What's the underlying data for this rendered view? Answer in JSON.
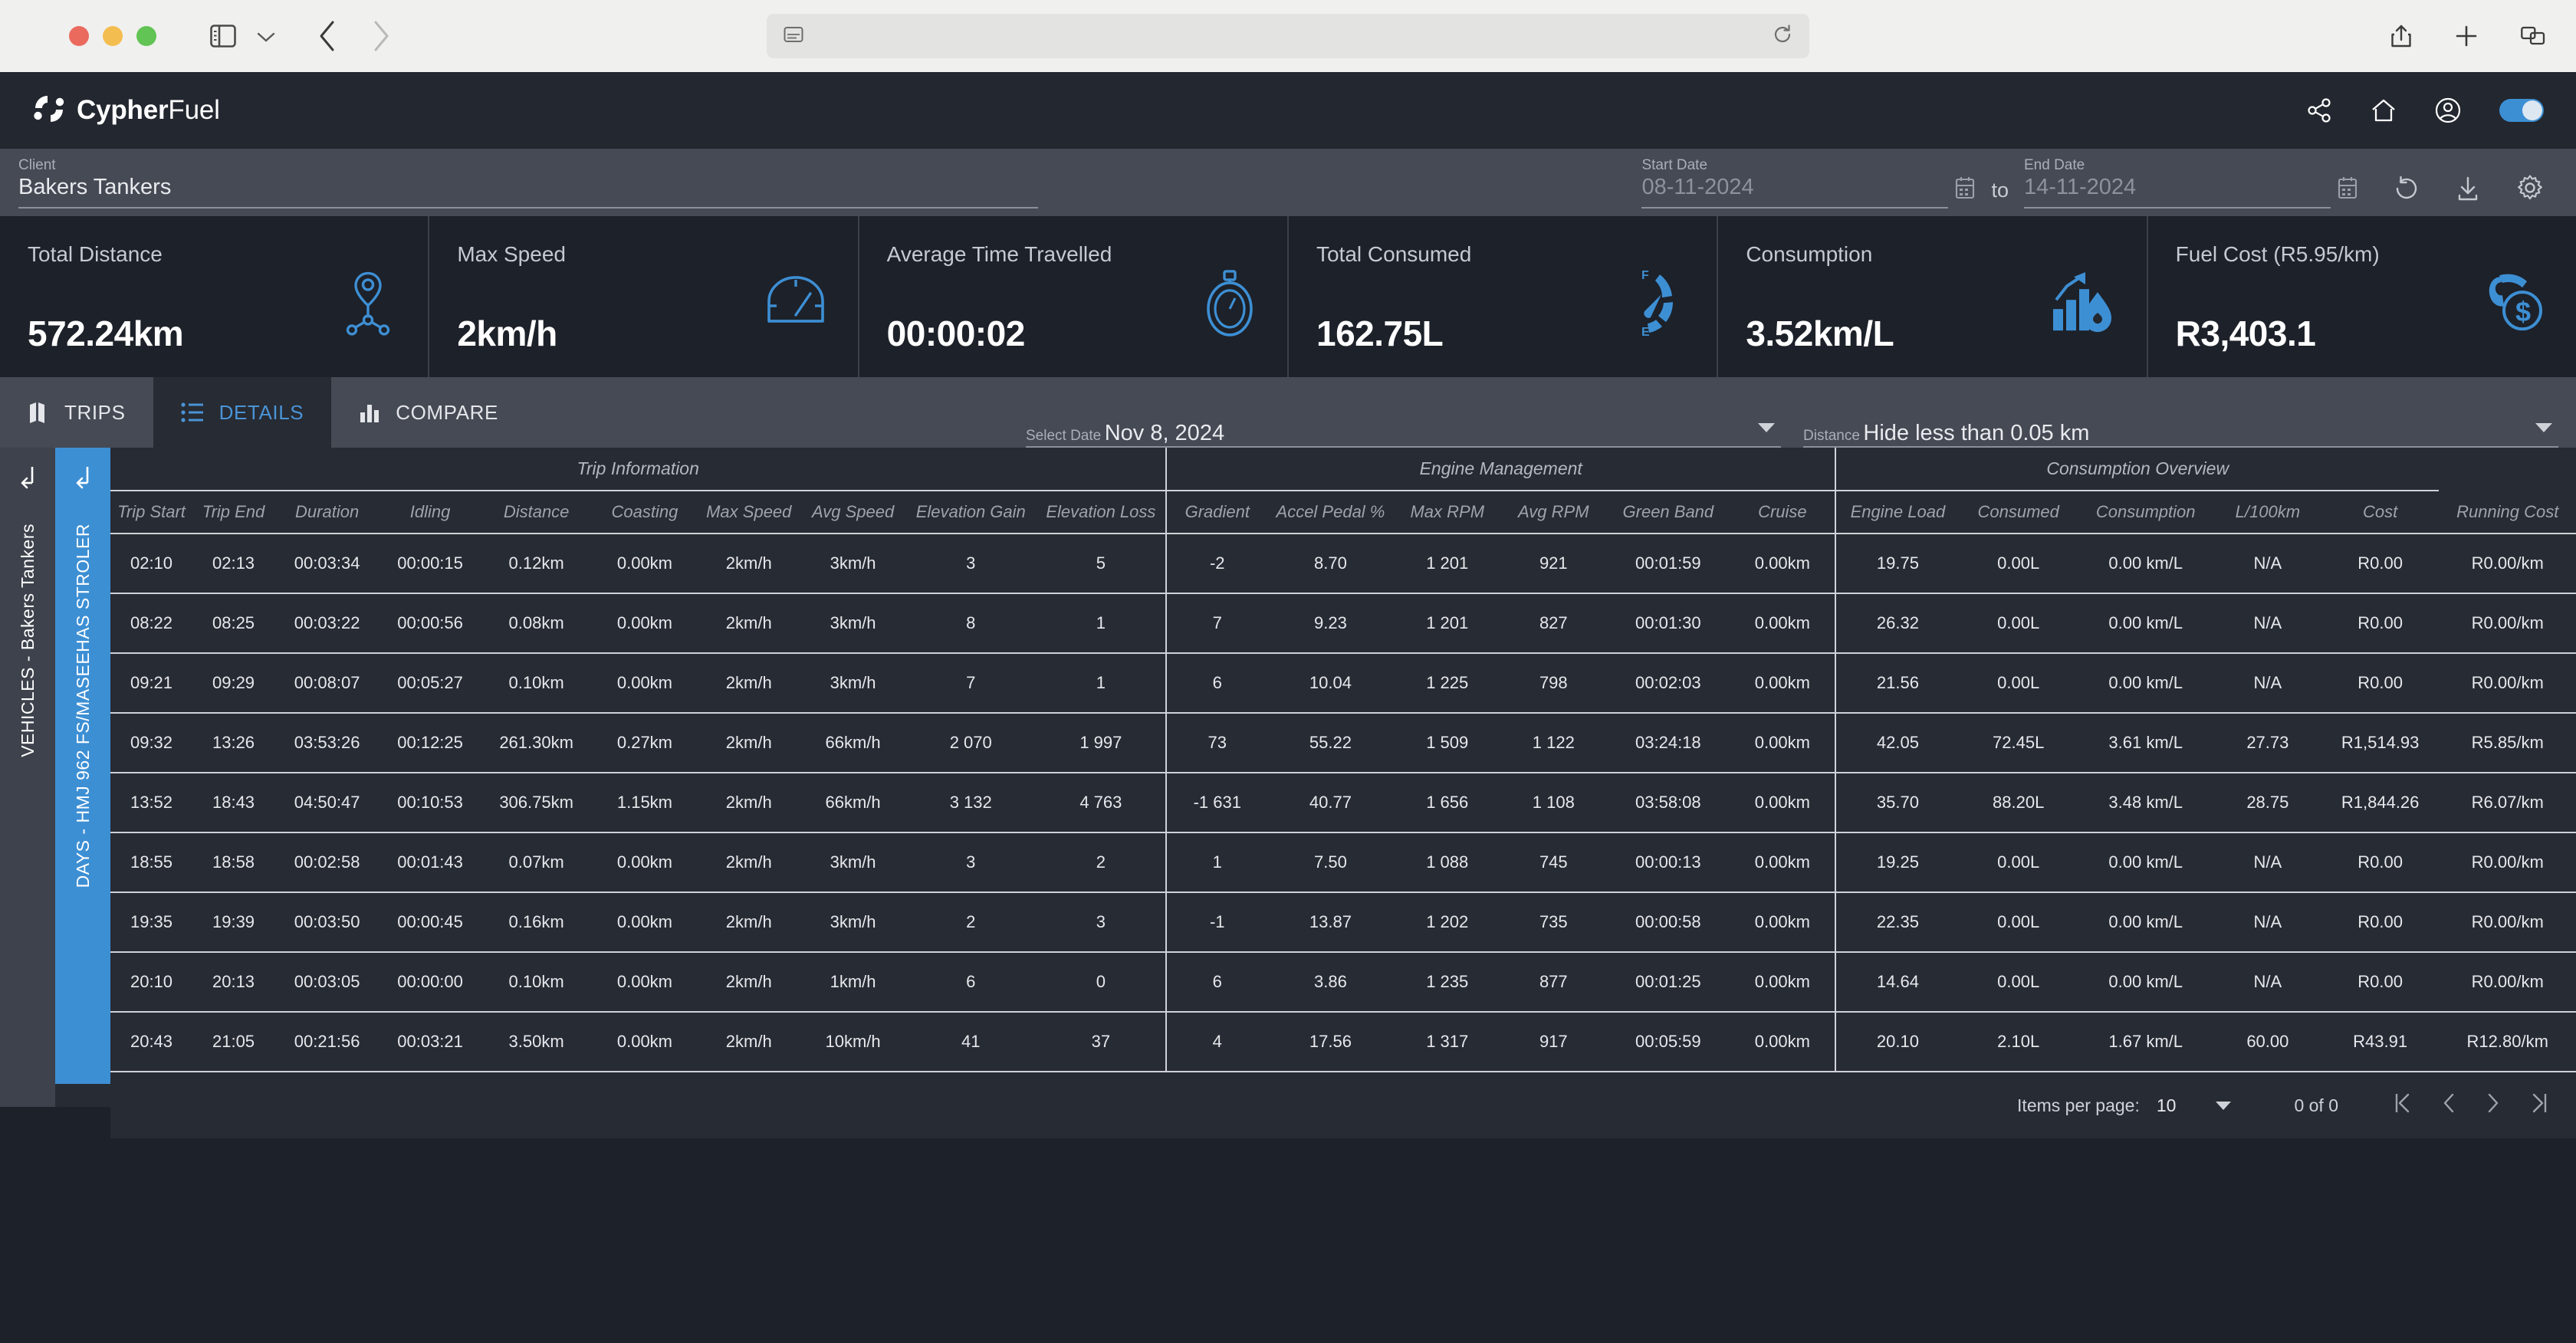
{
  "browser": {
    "traffic_lights": [
      "close",
      "minimize",
      "maximize"
    ],
    "sidebar_toggle_icon": "sidebar-icon",
    "tab_overview_icon": "chevron-down-icon",
    "back_icon": "chevron-left-icon",
    "forward_icon": "chevron-right-icon",
    "url_value": "",
    "url_placeholder": "",
    "reader_icon": "reader-view-icon",
    "reload_icon": "reload-icon",
    "share_icon": "share-icon",
    "new_tab_icon": "plus-icon",
    "tabs_icon": "tab-overview-icon"
  },
  "app_header": {
    "brand_bold": "Cypher",
    "brand_light": "Fuel",
    "logo_icon": "cypherfuel-logo-icon",
    "icons": [
      "share-icon",
      "home-icon",
      "account-icon"
    ],
    "theme_toggle": "dark-mode-toggle",
    "accent_color": "#3d8fd4"
  },
  "filters": {
    "client": {
      "label": "Client",
      "value": "Bakers Tankers"
    },
    "start_date": {
      "label": "Start Date",
      "value": "08-11-2024",
      "icon": "calendar-icon"
    },
    "separator": "to",
    "end_date": {
      "label": "End Date",
      "value": "14-11-2024",
      "icon": "calendar-icon"
    },
    "actions": [
      "refresh-icon",
      "download-icon",
      "settings-icon"
    ]
  },
  "kpis": [
    {
      "label": "Total Distance",
      "value": "572.24km",
      "icon": "route-pin-icon"
    },
    {
      "label": "Max Speed",
      "value": "2km/h",
      "icon": "speedometer-icon"
    },
    {
      "label": "Average Time Travelled",
      "value": "00:00:02",
      "icon": "stopwatch-icon"
    },
    {
      "label": "Total Consumed",
      "value": "162.75L",
      "icon": "fuel-gauge-icon"
    },
    {
      "label": "Consumption",
      "value": "3.52km/L",
      "icon": "bar-chart-droplet-icon"
    },
    {
      "label": "Fuel Cost (R5.95/km)",
      "value": "R3,403.1",
      "icon": "fuel-pump-dollar-icon"
    }
  ],
  "tabs": [
    {
      "label": "TRIPS",
      "icon": "map-icon",
      "active": false
    },
    {
      "label": "DETAILS",
      "icon": "list-icon",
      "active": true
    },
    {
      "label": "COMPARE",
      "icon": "bar-chart-icon",
      "active": false
    }
  ],
  "selectors": {
    "select_date": {
      "label": "Select Date",
      "value": "Nov 8, 2024"
    },
    "distance": {
      "label": "Distance",
      "value": "Hide less than 0.05 km"
    }
  },
  "side_rails": {
    "level1": {
      "text": "VEHICLES - Bakers Tankers",
      "arrow_icon": "collapse-arrow-icon"
    },
    "level2": {
      "text": "DAYS - HMJ 962 FS/MASEEHAS STROLER",
      "arrow_icon": "collapse-arrow-icon"
    }
  },
  "table": {
    "groups": [
      {
        "title": "Trip Information",
        "span": 10
      },
      {
        "title": "Engine Management",
        "span": 6
      },
      {
        "title": "Consumption Overview",
        "span": 5
      }
    ],
    "columns": [
      "Trip Start",
      "Trip End",
      "Duration",
      "Idling",
      "Distance",
      "Coasting",
      "Max Speed",
      "Avg Speed",
      "Elevation Gain",
      "Elevation Loss",
      "Gradient",
      "Accel Pedal %",
      "Max RPM",
      "Avg RPM",
      "Green Band",
      "Cruise",
      "Engine Load",
      "Consumed",
      "Consumption",
      "L/100km",
      "Cost",
      "Running Cost"
    ],
    "rows": [
      [
        "02:10",
        "02:13",
        "00:03:34",
        "00:00:15",
        "0.12km",
        "0.00km",
        "2km/h",
        "3km/h",
        "3",
        "5",
        "-2",
        "8.70",
        "1 201",
        "921",
        "00:01:59",
        "0.00km",
        "19.75",
        "0.00L",
        "0.00 km/L",
        "N/A",
        "R0.00",
        "R0.00/km"
      ],
      [
        "08:22",
        "08:25",
        "00:03:22",
        "00:00:56",
        "0.08km",
        "0.00km",
        "2km/h",
        "3km/h",
        "8",
        "1",
        "7",
        "9.23",
        "1 201",
        "827",
        "00:01:30",
        "0.00km",
        "26.32",
        "0.00L",
        "0.00 km/L",
        "N/A",
        "R0.00",
        "R0.00/km"
      ],
      [
        "09:21",
        "09:29",
        "00:08:07",
        "00:05:27",
        "0.10km",
        "0.00km",
        "2km/h",
        "3km/h",
        "7",
        "1",
        "6",
        "10.04",
        "1 225",
        "798",
        "00:02:03",
        "0.00km",
        "21.56",
        "0.00L",
        "0.00 km/L",
        "N/A",
        "R0.00",
        "R0.00/km"
      ],
      [
        "09:32",
        "13:26",
        "03:53:26",
        "00:12:25",
        "261.30km",
        "0.27km",
        "2km/h",
        "66km/h",
        "2 070",
        "1 997",
        "73",
        "55.22",
        "1 509",
        "1 122",
        "03:24:18",
        "0.00km",
        "42.05",
        "72.45L",
        "3.61 km/L",
        "27.73",
        "R1,514.93",
        "R5.85/km"
      ],
      [
        "13:52",
        "18:43",
        "04:50:47",
        "00:10:53",
        "306.75km",
        "1.15km",
        "2km/h",
        "66km/h",
        "3 132",
        "4 763",
        "-1 631",
        "40.77",
        "1 656",
        "1 108",
        "03:58:08",
        "0.00km",
        "35.70",
        "88.20L",
        "3.48 km/L",
        "28.75",
        "R1,844.26",
        "R6.07/km"
      ],
      [
        "18:55",
        "18:58",
        "00:02:58",
        "00:01:43",
        "0.07km",
        "0.00km",
        "2km/h",
        "3km/h",
        "3",
        "2",
        "1",
        "7.50",
        "1 088",
        "745",
        "00:00:13",
        "0.00km",
        "19.25",
        "0.00L",
        "0.00 km/L",
        "N/A",
        "R0.00",
        "R0.00/km"
      ],
      [
        "19:35",
        "19:39",
        "00:03:50",
        "00:00:45",
        "0.16km",
        "0.00km",
        "2km/h",
        "3km/h",
        "2",
        "3",
        "-1",
        "13.87",
        "1 202",
        "735",
        "00:00:58",
        "0.00km",
        "22.35",
        "0.00L",
        "0.00 km/L",
        "N/A",
        "R0.00",
        "R0.00/km"
      ],
      [
        "20:10",
        "20:13",
        "00:03:05",
        "00:00:00",
        "0.10km",
        "0.00km",
        "2km/h",
        "1km/h",
        "6",
        "0",
        "6",
        "3.86",
        "1 235",
        "877",
        "00:01:25",
        "0.00km",
        "14.64",
        "0.00L",
        "0.00 km/L",
        "N/A",
        "R0.00",
        "R0.00/km"
      ],
      [
        "20:43",
        "21:05",
        "00:21:56",
        "00:03:21",
        "3.50km",
        "0.00km",
        "2km/h",
        "10km/h",
        "41",
        "37",
        "4",
        "17.56",
        "1 317",
        "917",
        "00:05:59",
        "0.00km",
        "20.10",
        "2.10L",
        "1.67 km/L",
        "60.00",
        "R43.91",
        "R12.80/km"
      ]
    ]
  },
  "paginator": {
    "items_per_page_label": "Items per page:",
    "items_per_page_value": "10",
    "range_label": "0 of 0",
    "first_icon": "first-page-icon",
    "prev_icon": "previous-page-icon",
    "next_icon": "next-page-icon",
    "last_icon": "last-page-icon"
  }
}
